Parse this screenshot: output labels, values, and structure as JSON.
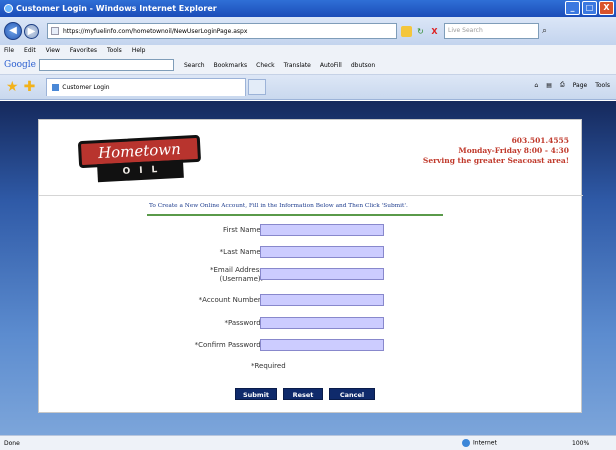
{
  "window": {
    "title": "Customer Login - Windows Internet Explorer",
    "minimize": "_",
    "maximize": "□",
    "close": "X"
  },
  "address_bar": {
    "back": "◀",
    "forward": "▶",
    "url": "https://myfuelinfo.com/hometownoil/NewUserLoginPage.aspx",
    "refresh": "↻",
    "stop": "X",
    "search_placeholder": "Live Search",
    "search_icon": "⌕"
  },
  "menu": [
    "File",
    "Edit",
    "View",
    "Favorites",
    "Tools",
    "Help"
  ],
  "google_toolbar": {
    "logo": "Google",
    "items": [
      "Search",
      "Bookmarks",
      "Check",
      "Translate",
      "AutoFill",
      "dbutson"
    ]
  },
  "tab": {
    "label": "Customer Login"
  },
  "command_bar": [
    "Page",
    "Tools"
  ],
  "logo": {
    "top": "Hometown",
    "bottom": "OIL"
  },
  "contact": {
    "phone": "603.501.4555",
    "hours": "Monday-Friday 8:00 - 4:30",
    "tagline": "Serving the greater Seacoast area!"
  },
  "form": {
    "instructions": "To Create a New Online Account, Fill in the Information Below and Then Click 'Submit'.",
    "first_name": "First Name:",
    "last_name": "*Last Name:",
    "email_line1": "*Email Address",
    "email_line2": "(Username):",
    "account_number": "*Account Number:",
    "password": "*Password:",
    "confirm_password": "*Confirm Password:",
    "required": "*Required",
    "submit": "Submit",
    "reset": "Reset",
    "cancel": "Cancel"
  },
  "status": {
    "left": "Done",
    "zone": "Internet",
    "zoom": "100%"
  }
}
